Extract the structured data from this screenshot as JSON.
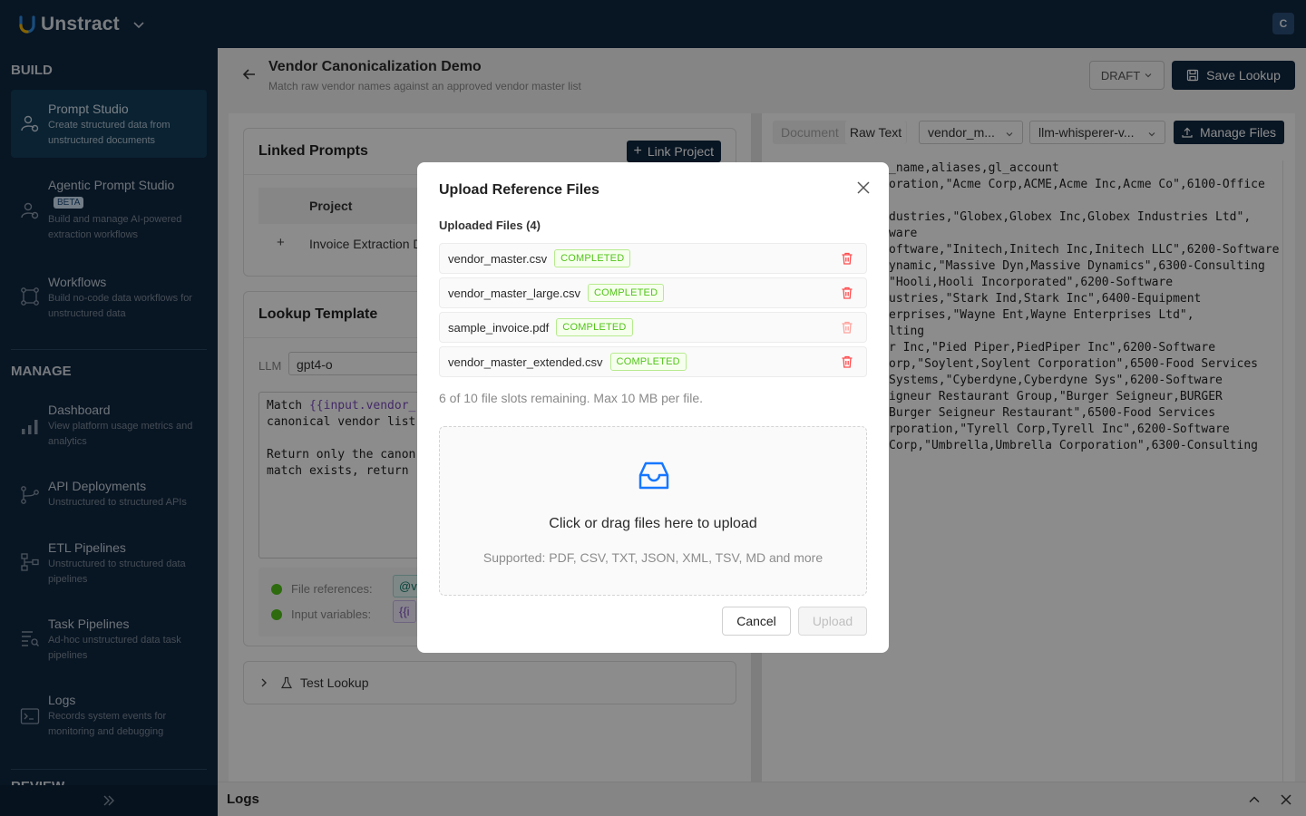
{
  "app": {
    "name": "Unstract",
    "avatar_initial": "C"
  },
  "sidebar": {
    "build_title": "BUILD",
    "manage_title": "MANAGE",
    "cut_title": "REVIEW",
    "items": [
      {
        "label": "Prompt Studio",
        "desc": "Create structured data from unstructured documents"
      },
      {
        "label": "Agentic Prompt Studio",
        "badge": "BETA",
        "desc": "Build and manage AI-powered extraction workflows"
      },
      {
        "label": "Workflows",
        "desc": "Build no-code data workflows for unstructured data"
      },
      {
        "label": "Dashboard",
        "desc": "View platform usage metrics and analytics"
      },
      {
        "label": "API Deployments",
        "desc": "Unstructured to structured APIs"
      },
      {
        "label": "ETL Pipelines",
        "desc": "Unstructured to structured data pipelines"
      },
      {
        "label": "Task Pipelines",
        "desc": "Ad-hoc unstructured data task pipelines"
      },
      {
        "label": "Logs",
        "desc": "Records system events for monitoring and debugging"
      }
    ]
  },
  "page": {
    "title": "Vendor Canonicalization Demo",
    "subtitle": "Match raw vendor names against an approved vendor master list",
    "status": "DRAFT",
    "save_label": "Save Lookup"
  },
  "linked": {
    "title": "Linked Prompts",
    "button": "Link Project",
    "column": "Project",
    "row": "Invoice Extraction D"
  },
  "template": {
    "title": "Lookup Template",
    "llm_label": "LLM",
    "llm_value": "gpt4-o",
    "prompt_line1_pre": "Match ",
    "prompt_line1_var": "{{input.vendor_",
    "prompt_line2": "canonical vendor list",
    "prompt_line4": "Return only the canon",
    "prompt_line5": "match exists, return ",
    "file_refs_label": "File references:",
    "file_refs_chip": "@v",
    "input_vars_label": "Input variables:",
    "input_vars_chip": "{{i"
  },
  "test": {
    "label": "Test Lookup"
  },
  "right": {
    "tab_document": "Document",
    "tab_raw": "Raw Text",
    "file_select": "vendor_m...",
    "mode_select": "llm-whisperer-v...",
    "manage_files": "Manage Files",
    "lines": [
      "_name,aliases,gl_account",
      "oration,\"Acme Corp,ACME,Acme Inc,Acme Co\",6100-Office",
      "",
      "dustries,\"Globex,Globex Inc,Globex Industries Ltd\",",
      "ware",
      "oftware,\"Initech,Initech Inc,Initech LLC\",6200-Software",
      "ynamic,\"Massive Dyn,Massive Dynamics\",6300-Consulting",
      "\"Hooli,Hooli Incorporated\",6200-Software",
      "ustries,\"Stark Ind,Stark Inc\",6400-Equipment",
      "erprises,\"Wayne Ent,Wayne Enterprises Ltd\",",
      "lting",
      "r Inc,\"Pied Piper,PiedPiper Inc\",6200-Software",
      "orp,\"Soylent,Soylent Corporation\",6500-Food Services",
      "Systems,\"Cyberdyne,Cyberdyne Sys\",6200-Software",
      "igneur Restaurant Group,\"Burger Seigneur,BURGER",
      "Burger Seigneur Restaurant\",6500-Food Services",
      "rporation,\"Tyrell Corp,Tyrell Inc\",6200-Software",
      "Corp,\"Umbrella,Umbrella Corporation\",6300-Consulting"
    ]
  },
  "logs": {
    "title": "Logs"
  },
  "modal": {
    "title": "Upload Reference Files",
    "uploaded_label": "Uploaded Files (4)",
    "files": [
      {
        "name": "vendor_master.csv",
        "status": "COMPLETED"
      },
      {
        "name": "vendor_master_large.csv",
        "status": "COMPLETED"
      },
      {
        "name": "sample_invoice.pdf",
        "status": "COMPLETED"
      },
      {
        "name": "vendor_master_extended.csv",
        "status": "COMPLETED"
      }
    ],
    "slots_text": "6 of 10 file slots remaining. Max 10 MB per file.",
    "drop_text": "Click or drag files here to upload",
    "drop_hint": "Supported: PDF, CSV, TXT, JSON, XML, TSV, MD and more",
    "cancel_label": "Cancel",
    "upload_label": "Upload"
  },
  "colors": {
    "navy": "#0f2740",
    "accent_blue": "#1677ff",
    "success": "#52c41a",
    "danger": "#ff4d4f"
  }
}
